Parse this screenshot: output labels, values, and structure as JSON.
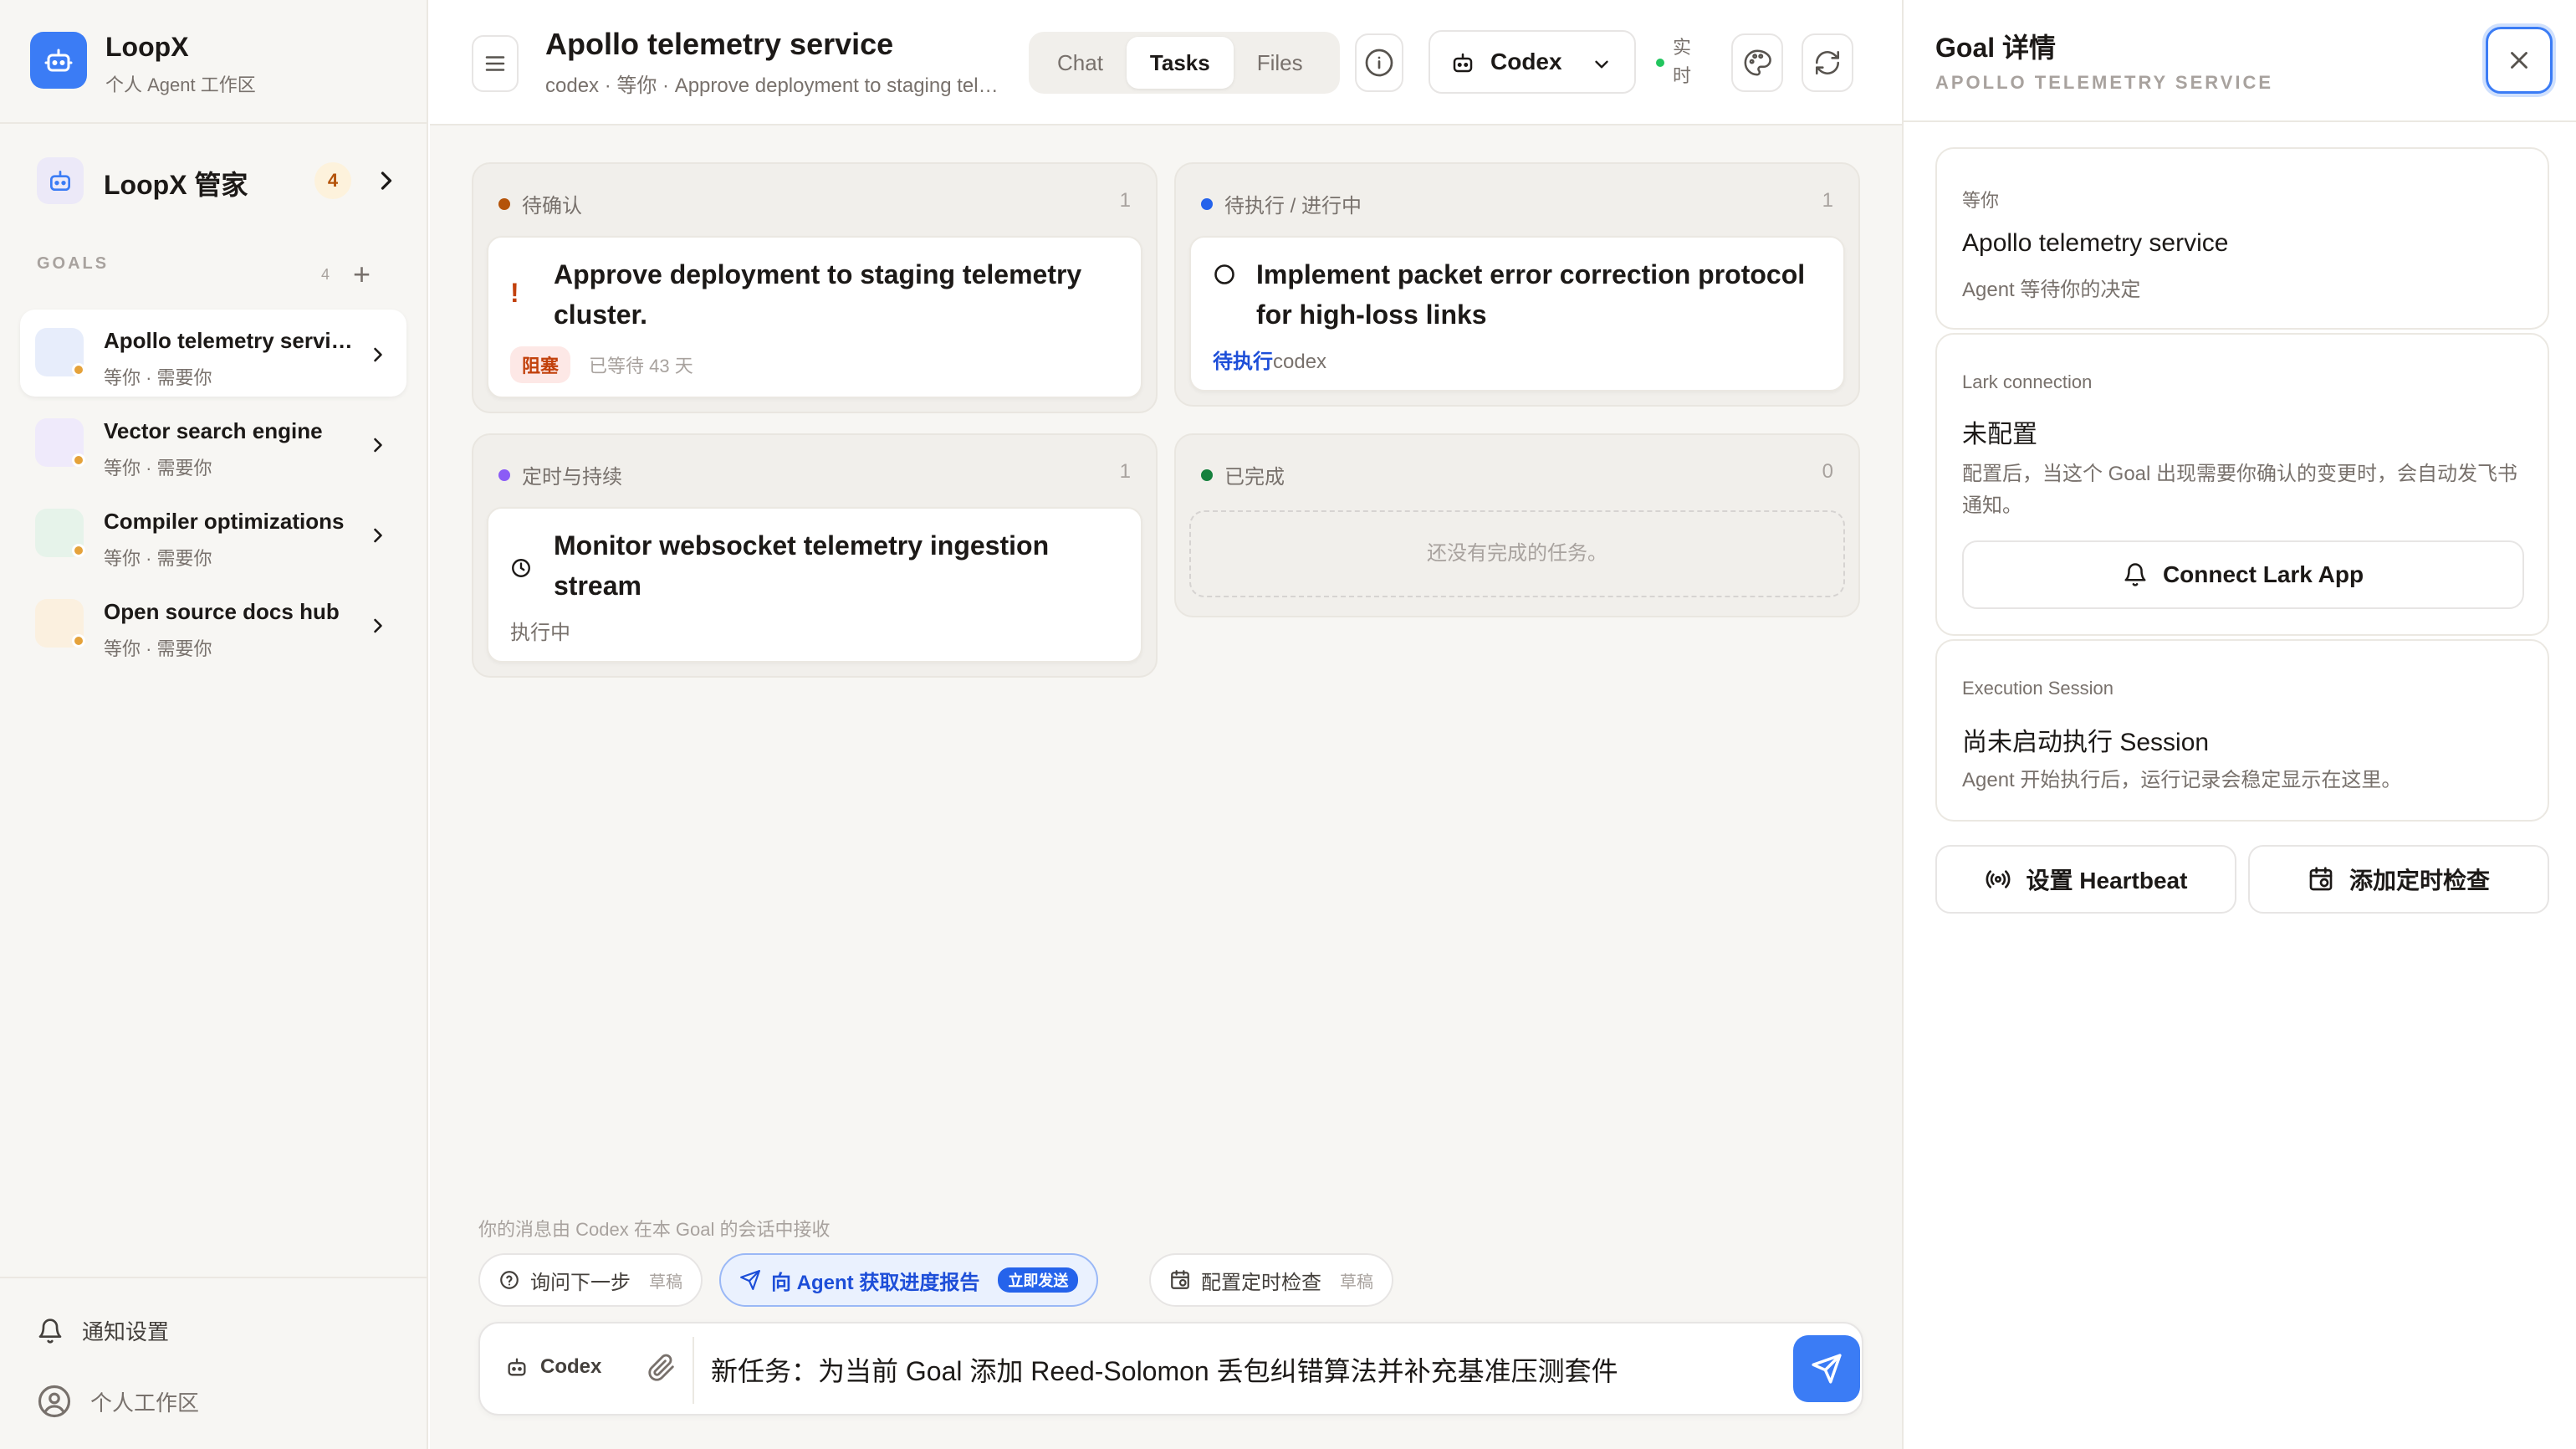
{
  "brand": {
    "title": "LoopX",
    "subtitle": "个人 Agent 工作区",
    "logo_icon": "robot-icon",
    "color": "#3b7cf5"
  },
  "butler": {
    "label": "LoopX 管家",
    "badge": "4"
  },
  "goals": {
    "section_label": "GOALS",
    "count": "4",
    "add_label": "+",
    "items": [
      {
        "title": "Apollo telemetry service",
        "sub": "等你 · 需要你",
        "tint": "#e7edfb",
        "active": true
      },
      {
        "title": "Vector search engine",
        "sub": "等你 · 需要你",
        "tint": "#efeafb"
      },
      {
        "title": "Compiler optimizations",
        "sub": "等你 · 需要你",
        "tint": "#e6f3ea"
      },
      {
        "title": "Open source docs hub",
        "sub": "等你 · 需要你",
        "tint": "#fbf0df"
      }
    ]
  },
  "sidebar_footer": {
    "notifications": "通知设置",
    "workspace": "个人工作区"
  },
  "header": {
    "title": "Apollo telemetry service",
    "subtitle": "codex · 等你 · Approve deployment to staging telemetry cluster.",
    "tabs": [
      "Chat",
      "Tasks",
      "Files"
    ],
    "active_tab": "Tasks",
    "agent": "Codex",
    "live": "实时"
  },
  "board": {
    "columns": [
      {
        "name": "待确认",
        "count": "1",
        "color": "#b45309",
        "cards": [
          {
            "title_line1": "Approve deployment to staging telemetry",
            "title_line2": "cluster.",
            "tag": "阻塞",
            "meta": "已等待 43 天"
          }
        ]
      },
      {
        "name": "待执行 / 进行中",
        "count": "1",
        "color": "#2563eb",
        "cards": [
          {
            "title_line1": "Implement packet error correction protocol",
            "title_line2": "for high-loss links",
            "status": "待执行",
            "agent": "codex"
          }
        ]
      },
      {
        "name": "定时与持续",
        "count": "1",
        "color": "#8b5cf6",
        "cards": [
          {
            "title_line1": "Monitor websocket telemetry ingestion",
            "title_line2": "stream",
            "status": "执行中"
          }
        ]
      },
      {
        "name": "已完成",
        "count": "0",
        "color": "#15803d",
        "empty": "还没有完成的任务。"
      }
    ]
  },
  "composer": {
    "hint": "你的消息由 Codex 在本 Goal 的会话中接收",
    "chips": [
      {
        "label": "询问下一步",
        "tag": "草稿"
      },
      {
        "label": "向 Agent 获取进度报告",
        "tag": "立即发送"
      },
      {
        "label": "配置定时检查",
        "tag": "草稿"
      }
    ],
    "agent": "Codex",
    "input_value": "新任务：为当前 Goal 添加 Reed-Solomon 丢包纠错算法并补充基准压测套件"
  },
  "panel": {
    "title": "Goal 详情",
    "subtitle": "APOLLO TELEMETRY SERVICE",
    "status_card": {
      "eyebrow": "等你",
      "main": "Apollo telemetry service",
      "desc": "Agent 等待你的决定"
    },
    "lark_card": {
      "eyebrow": "Lark connection",
      "main": "未配置",
      "desc": "配置后，当这个 Goal 出现需要你确认的变更时，会自动发飞书通知。",
      "button": "Connect Lark App"
    },
    "session_card": {
      "eyebrow": "Execution Session",
      "main": "尚未启动执行 Session",
      "desc": "Agent 开始执行后，运行记录会稳定显示在这里。"
    },
    "heartbeat_button": "设置 Heartbeat",
    "schedule_button": "添加定时检查"
  }
}
